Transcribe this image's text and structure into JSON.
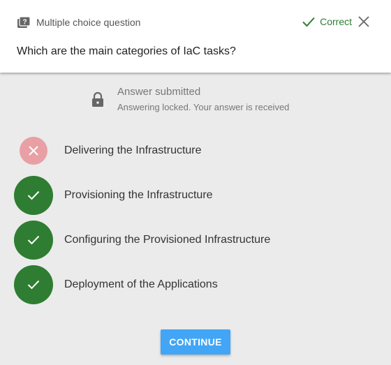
{
  "header": {
    "question_type": "Multiple choice question",
    "question_type_icon": "question-box-icon",
    "status_label": "Correct",
    "status_icon": "check-icon",
    "status_color": "#2e7d32",
    "close_icon": "close-icon"
  },
  "question": {
    "text": "Which are the main categories of IaC tasks?"
  },
  "submission": {
    "icon": "lock-icon",
    "title": "Answer submitted",
    "subtitle": "Answering locked. Your answer is received"
  },
  "answers": [
    {
      "label": "Delivering the Infrastructure",
      "state": "incorrect",
      "icon": "x-icon"
    },
    {
      "label": "Provisioning the Infrastructure",
      "state": "correct",
      "icon": "check-icon"
    },
    {
      "label": "Configuring the Provisioned Infrastructure",
      "state": "correct",
      "icon": "check-icon"
    },
    {
      "label": "Deployment of the Applications",
      "state": "correct",
      "icon": "check-icon"
    }
  ],
  "colors": {
    "correct": "#2e7d32",
    "incorrect": "#e8a0a5",
    "button": "#42a5f5",
    "background": "#ebebeb"
  },
  "continue_button": {
    "label": "CONTINUE"
  }
}
